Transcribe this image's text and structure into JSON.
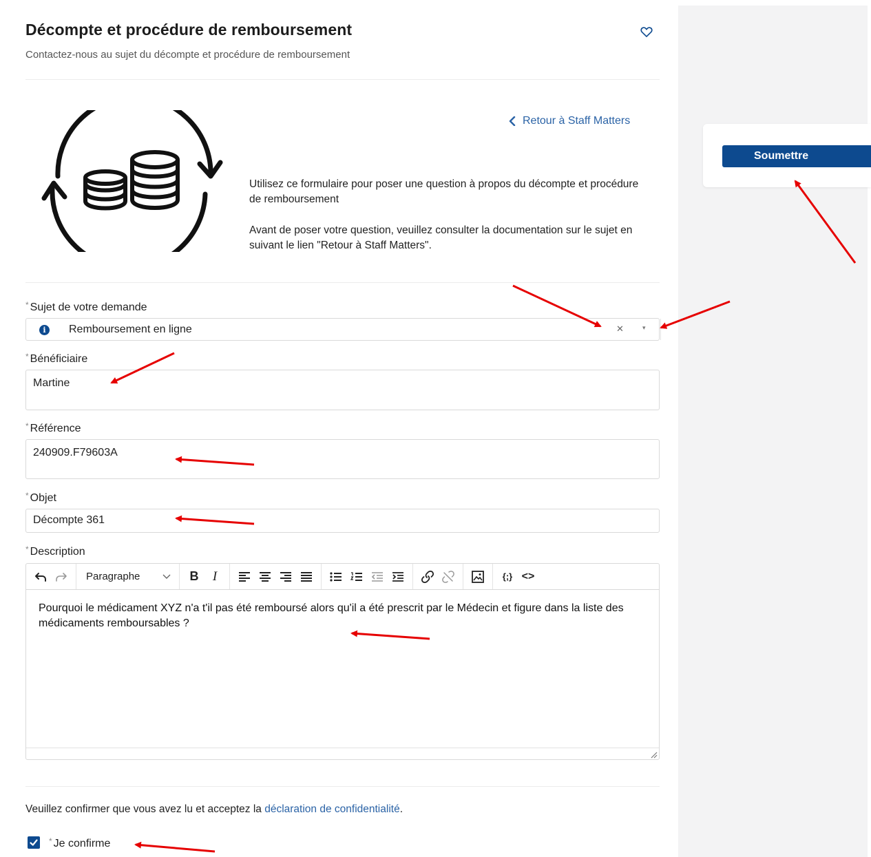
{
  "page": {
    "title": "Décompte et procédure de remboursement",
    "subtitle": "Contactez-nous au sujet du décompte et procédure de remboursement"
  },
  "sidebar": {
    "submit_label": "Soumettre"
  },
  "intro": {
    "back_link": "Retour à Staff Matters",
    "paragraph1": "Utilisez ce formulaire pour poser une question à propos du décompte et procédure de remboursement",
    "paragraph2": "Avant de poser votre question, veuillez consulter la documentation sur le sujet en suivant le lien \"Retour à Staff Matters\"."
  },
  "form": {
    "required_mark": "*",
    "subject": {
      "label": "Sujet de votre demande",
      "value": "Remboursement en ligne",
      "info_glyph": "i",
      "clear_glyph": "✕",
      "caret_glyph": "▾"
    },
    "beneficiary": {
      "label": "Bénéficiaire",
      "value": "Martine"
    },
    "reference": {
      "label": "Référence",
      "value": "240909.F79603A"
    },
    "object": {
      "label": "Objet",
      "value": "Décompte 361"
    },
    "description": {
      "label": "Description",
      "format": "Paragraphe",
      "bold_glyph": "B",
      "italic_glyph": "I",
      "code_glyph": "{;}",
      "source_glyph": "<>",
      "body": "Pourquoi le médicament XYZ n'a t'il pas été remboursé alors qu'il a été prescrit par le Médecin et figure dans la liste des médicaments remboursables ?"
    },
    "consent": {
      "text": "Veuillez confirmer que vous avez lu et acceptez la ",
      "link": "déclaration de confidentialité",
      "end": "."
    },
    "confirm": {
      "label": "Je confirme",
      "checked": true
    }
  },
  "icons": {
    "favorite": "heart-icon",
    "back": "chevron-left-icon",
    "illustration": "coins-cycle-icon"
  },
  "colors": {
    "primary": "#0d4a8f",
    "link": "#2b63a6",
    "annotation": "#e60000"
  }
}
